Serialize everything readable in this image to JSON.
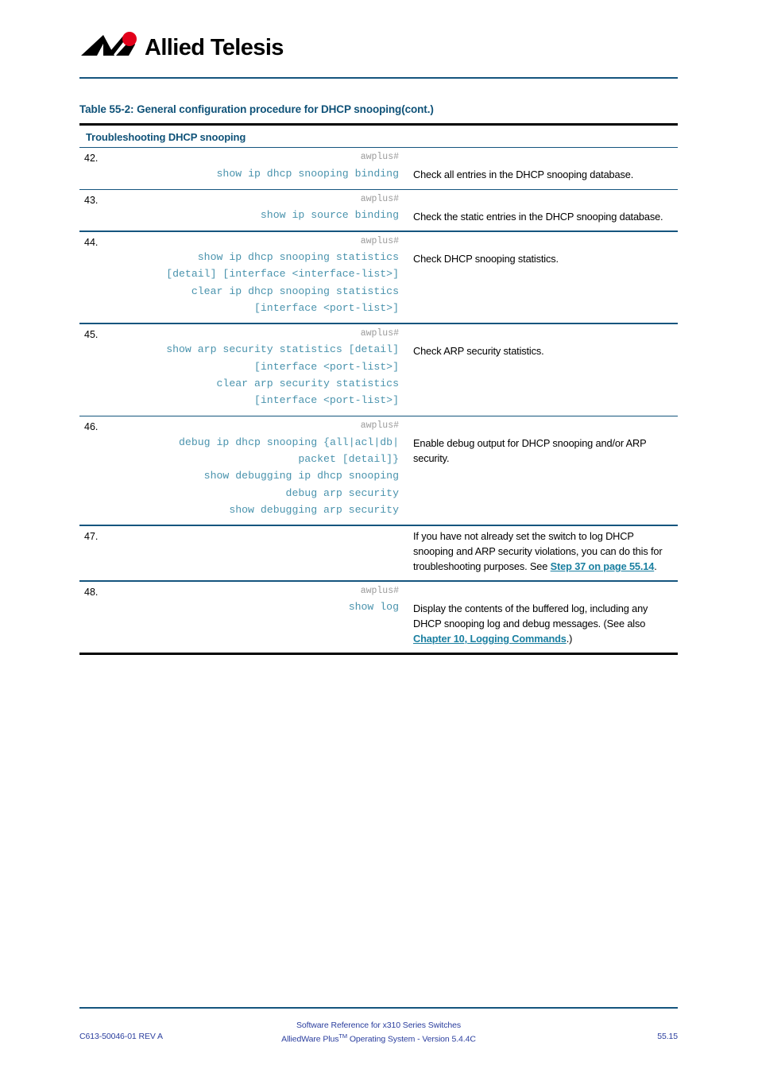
{
  "header": {
    "logo_text": "Allied Telesis",
    "logo_icon": "allied-telesis-logo"
  },
  "table": {
    "title": "Table 55-2: General configuration procedure for DHCP snooping(cont.)",
    "section_heading": "Troubleshooting DHCP snooping",
    "title_color": "#0f5278",
    "command_color": "#4a93ad",
    "prompt_color": "#9a9a9a",
    "link_color": "#1a7fa0",
    "rule_color": "#15557e",
    "rows": [
      {
        "number": "42.",
        "prompt": "awplus#",
        "commands": [
          "show ip dhcp snooping binding"
        ],
        "description": "Check all entries in the DHCP snooping database."
      },
      {
        "number": "43.",
        "prompt": "awplus#",
        "commands": [
          "show ip source binding"
        ],
        "description": "Check the static entries in the DHCP snooping database."
      },
      {
        "number": "44.",
        "prompt": "awplus#",
        "commands": [
          "show ip dhcp snooping statistics",
          "[detail] [interface <interface-list>]",
          "clear ip dhcp snooping statistics",
          "[interface <port-list>]"
        ],
        "description": "Check DHCP snooping statistics."
      },
      {
        "number": "45.",
        "prompt": "awplus#",
        "commands": [
          "show arp security statistics [detail]",
          "[interface <port-list>]",
          "clear arp security statistics",
          "[interface <port-list>]"
        ],
        "description": "Check ARP security statistics."
      },
      {
        "number": "46.",
        "prompt": "awplus#",
        "commands": [
          "debug ip dhcp snooping {all|acl|db|",
          "packet [detail]}",
          "show debugging ip dhcp snooping",
          "debug arp security",
          "show debugging arp security"
        ],
        "description": "Enable debug output for DHCP snooping and/or ARP security."
      },
      {
        "number": "47.",
        "prompt": "",
        "commands": [],
        "description_parts": [
          {
            "type": "text",
            "value": "If you have not already set the switch to log DHCP snooping and ARP security violations, you can do this for troubleshooting purposes. See "
          },
          {
            "type": "link",
            "value": "Step 37 on page 55.14"
          },
          {
            "type": "text",
            "value": "."
          }
        ]
      },
      {
        "number": "48.",
        "prompt": "awplus#",
        "commands": [
          "show log"
        ],
        "description_parts": [
          {
            "type": "text",
            "value": "Display the contents of the buffered log, including any DHCP snooping log and debug messages. (See also "
          },
          {
            "type": "link",
            "value": "Chapter 10, Logging Commands"
          },
          {
            "type": "text",
            "value": ".)"
          }
        ]
      }
    ]
  },
  "footer": {
    "line1": "Software Reference for x310 Series Switches",
    "line2_pre": "AlliedWare Plus",
    "line2_sup": "TM",
    "line2_post": " Operating System - Version 5.4.4C",
    "doc_id": "C613-50046-01 REV A",
    "page_number": "55.15",
    "color": "#2a3e9e"
  }
}
